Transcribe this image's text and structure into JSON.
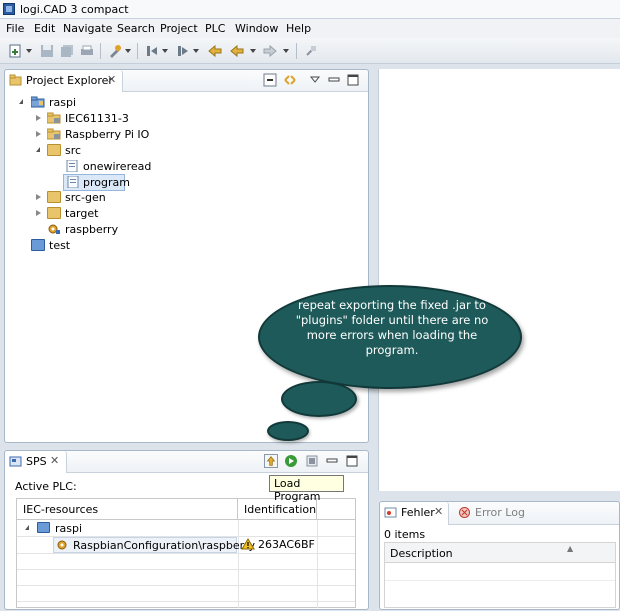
{
  "window": {
    "title": "logi.CAD 3 compact"
  },
  "menu": [
    "File",
    "Edit",
    "Navigate",
    "Search",
    "Project",
    "PLC",
    "Window",
    "Help"
  ],
  "project_explorer": {
    "tab_label": "Project Explorer",
    "tree": [
      {
        "label": "raspi",
        "icon": "project-folder-icon",
        "expanded": true
      },
      {
        "label": "IEC61131-3",
        "icon": "library-folder-icon",
        "expanded": false
      },
      {
        "label": "Raspberry Pi IO",
        "icon": "library-folder-icon",
        "expanded": false
      },
      {
        "label": "src",
        "icon": "folder-icon",
        "expanded": true
      },
      {
        "label": "onewireread",
        "icon": "st-file-icon"
      },
      {
        "label": "program",
        "icon": "st-file-icon",
        "selected": true
      },
      {
        "label": "src-gen",
        "icon": "folder-icon",
        "expanded": false
      },
      {
        "label": "target",
        "icon": "folder-icon",
        "expanded": false
      },
      {
        "label": "raspberry",
        "icon": "configuration-icon"
      },
      {
        "label": "test",
        "icon": "blue-folder-icon"
      }
    ]
  },
  "callout": {
    "text": "repeat exporting the fixed .jar to \"plugins\" folder until there are no more errors when loading the program."
  },
  "sps": {
    "tab_label": "SPS",
    "active_plc_label": "Active PLC:",
    "tooltip": "Load Program",
    "columns": [
      "IEC-resources",
      "Identification"
    ],
    "rows": [
      {
        "resource": "raspi",
        "identification": ""
      },
      {
        "resource": "RaspbianConfiguration\\raspberry",
        "identification": "263AC6BF",
        "warning": true
      }
    ]
  },
  "problems": {
    "tab_active": "Fehler",
    "tab_inactive": "Error Log",
    "count": "0 items",
    "columns": [
      "Description"
    ]
  },
  "colors": {
    "callout": "#1f5a5a",
    "selection": "#dbe8f8",
    "panel_border": "#a8b8c8"
  }
}
